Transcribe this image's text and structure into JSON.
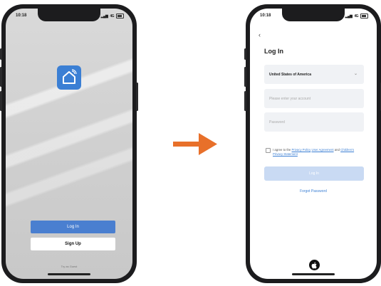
{
  "left_phone": {
    "status_time": "10:18",
    "status_signal": "4G",
    "login_label": "Log In",
    "signup_label": "Sign Up",
    "try_label": "Try as Guest"
  },
  "right_phone": {
    "status_time": "10:18",
    "status_signal": "4G",
    "title": "Log In",
    "country_value": "United States of America",
    "account_placeholder": "Please enter your account",
    "password_placeholder": "Password",
    "agree_prefix": "I agree to the",
    "privacy_link": "Privacy Policy",
    "user_agreement_link": "User Agreement",
    "and_text": "and",
    "children_link": "Children's Privacy Statement",
    "login_label": "Log In",
    "forgot_label": "Forgot Password"
  },
  "colors": {
    "accent": "#3b7fd4",
    "arrow": "#e8702a",
    "login_disabled": "#c9daf3"
  },
  "icons": {
    "app": "home-wifi-icon",
    "arrow": "right-arrow-icon",
    "apple": "apple-icon",
    "back": "chevron-left-icon"
  }
}
